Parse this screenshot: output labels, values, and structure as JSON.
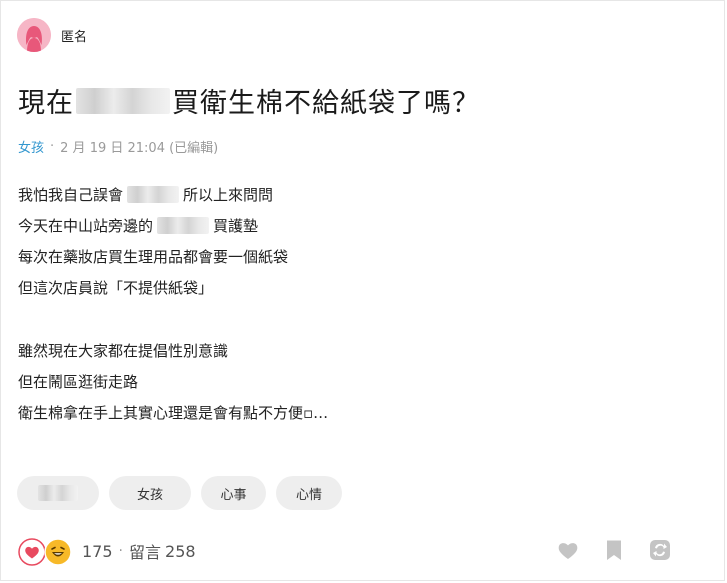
{
  "author": {
    "name": "匿名",
    "avatar_icon": "female-avatar-icon"
  },
  "post": {
    "title_before": "現在",
    "title_after": "買衛生棉不給紙袋了嗎？",
    "board": "女孩",
    "date": "2 月 19 日 21:04 (已編輯)",
    "lines": [
      {
        "before": "我怕我自己誤會",
        "after": "所以上來問問"
      },
      {
        "before": "今天在中山站旁邊的",
        "after": "買護墊"
      },
      {
        "text": "每次在藥妝店買生理用品都會要一個紙袋"
      },
      {
        "text": "但這次店員說「不提供紙袋」"
      },
      {
        "text": "雖然現在大家都在提倡性別意識"
      },
      {
        "text": "但在鬧區逛街走路"
      },
      {
        "text": "衛生棉拿在手上其實心理還是會有點不方便▫…"
      }
    ]
  },
  "tags": [
    "女孩",
    "心事",
    "心情"
  ],
  "stats": {
    "reaction_count": "175",
    "separator": "·",
    "comment_label": "留言",
    "comment_count": "258"
  },
  "colors": {
    "board_link": "#3397cf",
    "avatar_bg": "#f6b6c6",
    "heart": "#e84a5f",
    "laugh": "#f7b928",
    "action_icon": "#c4c4c4"
  }
}
